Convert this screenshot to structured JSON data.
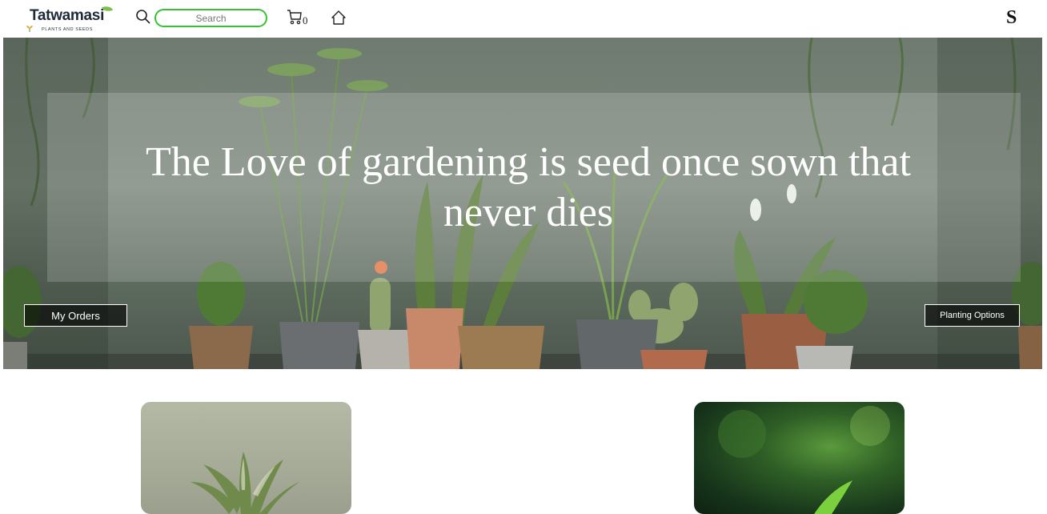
{
  "header": {
    "logo": {
      "brand_name": "Tatwamasi",
      "tagline": "PLANTS AND SEEDS",
      "icon": "leaf-icon"
    },
    "search": {
      "placeholder": "Search",
      "value": "",
      "icon": "search-icon",
      "accent_color": "#35c235"
    },
    "cart": {
      "icon": "cart-icon",
      "count": "0"
    },
    "home": {
      "icon": "home-icon"
    },
    "user_initial": "S"
  },
  "hero": {
    "quote": "The Love of gardening is seed once sown that never dies",
    "buttons": {
      "orders_label": "My Orders",
      "planting_label": "Planting Options"
    }
  },
  "product_cards": [
    {
      "image": "snake-plant-photo"
    },
    {
      "image": "green-leaf-photo"
    }
  ]
}
